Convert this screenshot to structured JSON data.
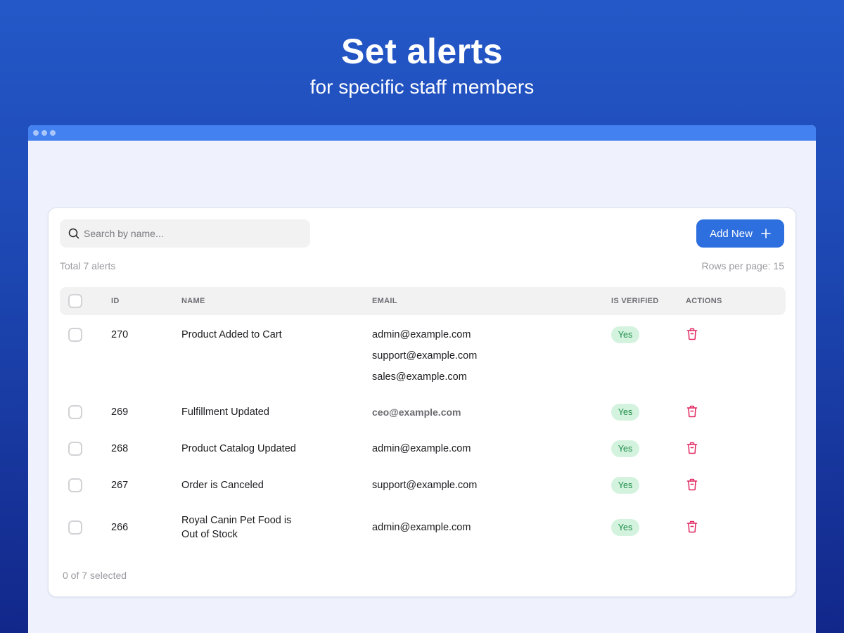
{
  "hero": {
    "title": "Set alerts",
    "subtitle": "for specific staff members"
  },
  "toolbar": {
    "search_placeholder": "Search by name...",
    "add_button_label": "Add New"
  },
  "summary": {
    "total": "Total 7 alerts",
    "rows_per_page": "Rows per page: 15"
  },
  "table": {
    "headers": {
      "id": "ID",
      "name": "NAME",
      "email": "EMAIL",
      "verified": "IS VERIFIED",
      "actions": "ACTIONS"
    },
    "rows": [
      {
        "id": "270",
        "name": "Product Added to Cart",
        "emails": [
          "admin@example.com",
          "support@example.com",
          "sales@example.com"
        ],
        "verified": "Yes"
      },
      {
        "id": "269",
        "name": "Fulfillment Updated",
        "emails": [
          "ceo@example.com"
        ],
        "verified": "Yes"
      },
      {
        "id": "268",
        "name": "Product Catalog Updated",
        "emails": [
          "admin@example.com"
        ],
        "verified": "Yes"
      },
      {
        "id": "267",
        "name": "Order is Canceled",
        "emails": [
          "support@example.com"
        ],
        "verified": "Yes"
      },
      {
        "id": "266",
        "name": "Royal Canin Pet Food is",
        "name_line2": "Out of Stock",
        "emails": [
          "admin@example.com"
        ],
        "verified": "Yes"
      }
    ]
  },
  "footer": {
    "selected": "0 of 7 selected"
  },
  "colors": {
    "accent": "#2d6fdf",
    "window_bar": "#4380f0",
    "verified_bg": "#d4f3df",
    "verified_text": "#1a8a44",
    "delete_icon": "#e0245e"
  },
  "icons": {
    "search": "search-icon",
    "add": "plus-icon",
    "delete": "trash-icon"
  }
}
